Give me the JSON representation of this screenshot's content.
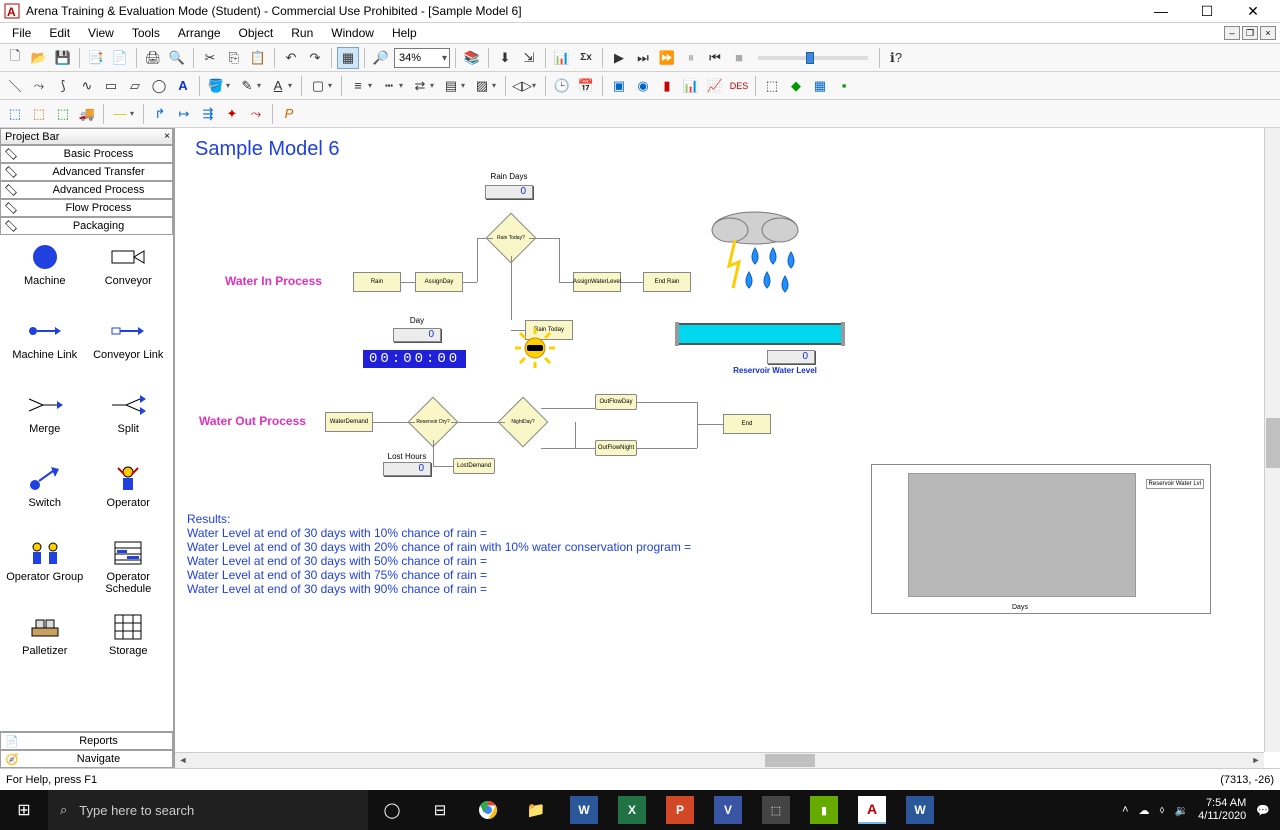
{
  "window": {
    "title": "Arena Training & Evaluation Mode (Student) - Commercial Use Prohibited - [Sample Model 6]"
  },
  "menubar": [
    "File",
    "Edit",
    "View",
    "Tools",
    "Arrange",
    "Object",
    "Run",
    "Window",
    "Help"
  ],
  "zoom_value": "34%",
  "projectbar": {
    "title": "Project Bar",
    "cats": [
      "Basic Process",
      "Advanced Transfer",
      "Advanced Process",
      "Flow Process",
      "Packaging"
    ],
    "items": [
      {
        "label": "Machine"
      },
      {
        "label": "Conveyor"
      },
      {
        "label": "Machine Link"
      },
      {
        "label": "Conveyor Link"
      },
      {
        "label": "Merge"
      },
      {
        "label": "Split"
      },
      {
        "label": "Switch"
      },
      {
        "label": "Operator"
      },
      {
        "label": "Operator Group"
      },
      {
        "label": "Operator Schedule"
      },
      {
        "label": "Palletizer"
      },
      {
        "label": "Storage"
      }
    ],
    "bottom": [
      "Reports",
      "Navigate"
    ]
  },
  "model": {
    "title": "Sample Model 6",
    "proc1": "Water In Process",
    "proc2": "Water Out Process",
    "rain_days_label": "Rain Days",
    "rain_days_val": "0",
    "day_label": "Day",
    "day_val": "0",
    "clock": "00:00:00",
    "lost_hours_label": "Lost Hours",
    "lost_hours_val": "0",
    "reservoir_label": "Reservoir Water Level",
    "reservoir_val": "0",
    "mods": {
      "rain": "Rain",
      "assignday": "AssignDay",
      "raintoday_q": "Rain Today?",
      "assignwl": "AssignWaterLevel",
      "endrain": "End Rain",
      "raintoday": "Rain Today",
      "waterdemand": "WaterDemand",
      "resdry": "Reservoir Dry?",
      "nightday": "NightDay?",
      "outday": "OutFlowDay",
      "outnight": "OutFlowNight",
      "end": "End",
      "lostdemand": "LostDemand"
    },
    "results_title": "Results:",
    "results": [
      "Water Level at end of 30 days with 10% chance of rain =",
      "Water Level at end of 30 days with 20% chance of rain with 10% water conservation program =",
      "Water Level at end of 30 days with 50% chance of rain =",
      "Water Level at end of 30 days with 75% chance of rain =",
      "Water Level at end of 30 days with 90% chance of rain ="
    ],
    "chart": {
      "xlabel": "Days",
      "legend": "Reservoir Water Lvl"
    }
  },
  "statusbar": {
    "left": "For Help, press F1",
    "right": "(7313, -26)"
  },
  "taskbar": {
    "search_placeholder": "Type here to search",
    "time": "7:54 AM",
    "date": "4/11/2020"
  }
}
